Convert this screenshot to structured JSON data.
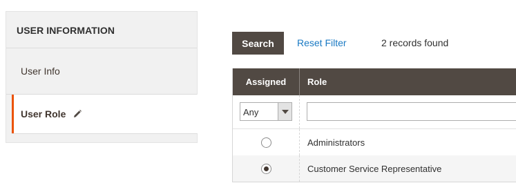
{
  "sidebar": {
    "title": "USER INFORMATION",
    "items": [
      {
        "label": "User Info"
      },
      {
        "label": "User Role",
        "active": true
      }
    ],
    "accent_color": "#eb5202"
  },
  "toolbar": {
    "search_label": "Search",
    "reset_label": "Reset Filter",
    "records_text": "2 records found"
  },
  "grid": {
    "columns": [
      "Assigned",
      "Role"
    ],
    "filter": {
      "assigned_value": "Any",
      "role_value": ""
    },
    "rows": [
      {
        "role": "Administrators",
        "assigned": false
      },
      {
        "role": "Customer Service Representative",
        "assigned": true
      }
    ],
    "header_color": "#514943"
  }
}
